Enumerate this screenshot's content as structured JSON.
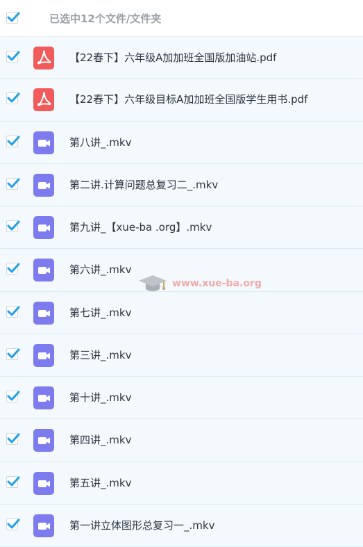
{
  "header": {
    "title": "已选中12个文件/文件夹",
    "select_all_checked": true
  },
  "colors": {
    "check_blue": "#1e9fe8",
    "pdf_icon": "#f25b5b",
    "video_icon": "#7c7cef",
    "row_background": "#f3f9fd"
  },
  "files": [
    {
      "name": "【22春下】六年级A加加班全国版加油站.pdf",
      "type": "pdf",
      "icon": "pdf-icon",
      "checked": true
    },
    {
      "name": "【22春下】六年级目标A加加班全国版学生用书.pdf",
      "type": "pdf",
      "icon": "pdf-icon",
      "checked": true
    },
    {
      "name": "第八讲_.mkv",
      "type": "video",
      "icon": "video-icon",
      "checked": true
    },
    {
      "name": "第二讲.计算问题总复习二_.mkv",
      "type": "video",
      "icon": "video-icon",
      "checked": true
    },
    {
      "name": "第九讲_【xue-ba .org】.mkv",
      "type": "video",
      "icon": "video-icon",
      "checked": true
    },
    {
      "name": "第六讲_.mkv",
      "type": "video",
      "icon": "video-icon",
      "checked": true
    },
    {
      "name": "第七讲_.mkv",
      "type": "video",
      "icon": "video-icon",
      "checked": true
    },
    {
      "name": "第三讲_.mkv",
      "type": "video",
      "icon": "video-icon",
      "checked": true
    },
    {
      "name": "第十讲_.mkv",
      "type": "video",
      "icon": "video-icon",
      "checked": true
    },
    {
      "name": "第四讲_.mkv",
      "type": "video",
      "icon": "video-icon",
      "checked": true
    },
    {
      "name": "第五讲_.mkv",
      "type": "video",
      "icon": "video-icon",
      "checked": true
    },
    {
      "name": "第一讲立体图形总复习一_.mkv",
      "type": "video",
      "icon": "video-icon",
      "checked": true
    }
  ],
  "watermark": {
    "text": "www.xue-ba.org"
  }
}
